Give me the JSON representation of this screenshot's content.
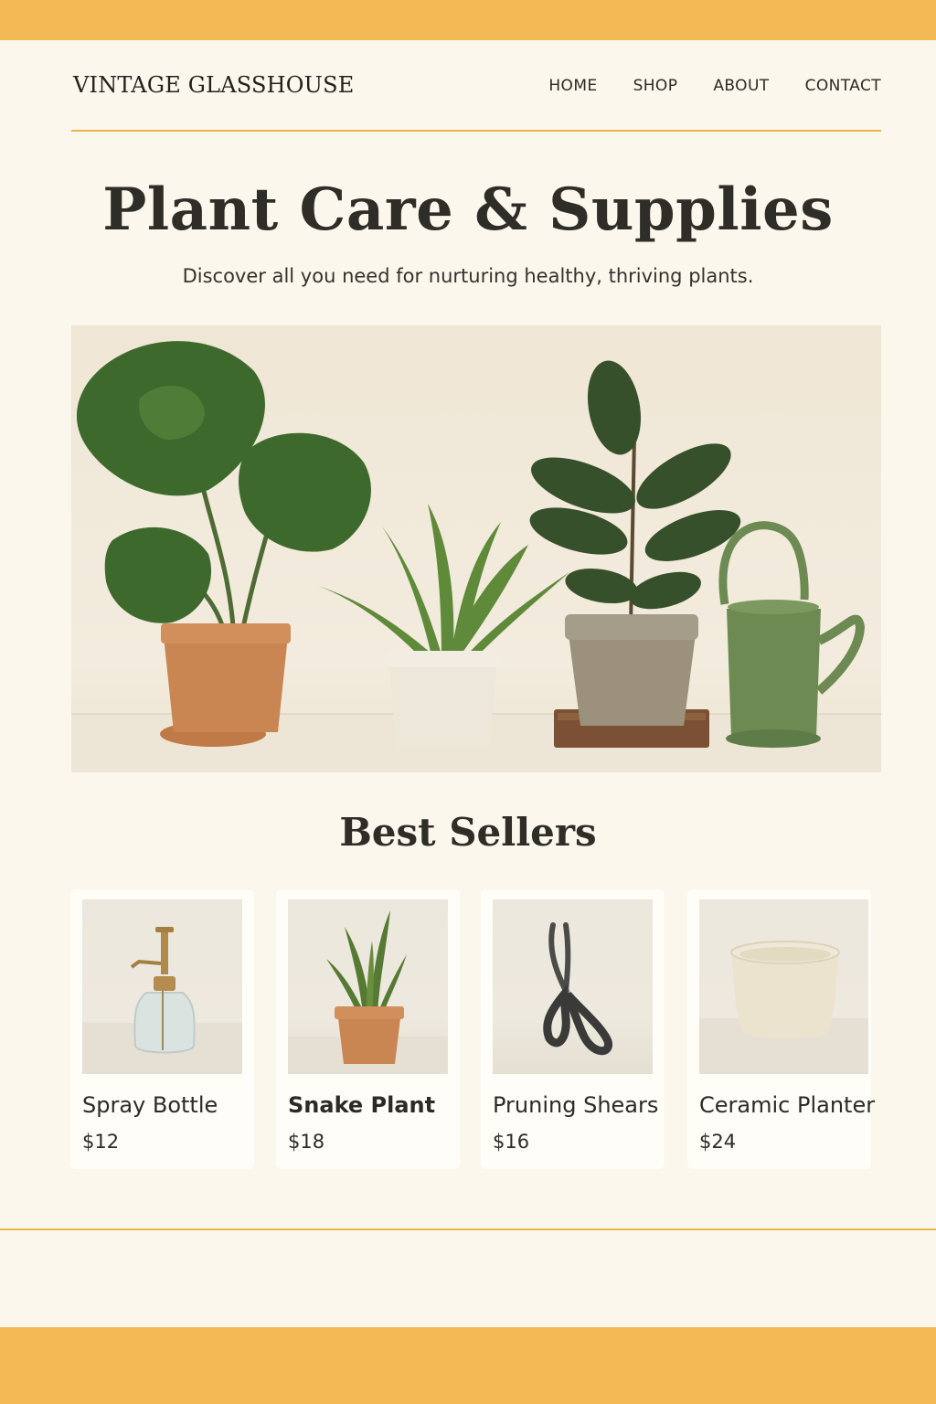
{
  "brand": "VINTAGE GLASSHOUSE",
  "nav": [
    "HOME",
    "SHOP",
    "ABOUT",
    "CONTACT"
  ],
  "hero": {
    "title": "Plant Care & Supplies",
    "subtitle": "Discover all you need for nurturing healthy, thriving plants.",
    "image": "plants-on-shelf-photo"
  },
  "best_sellers": {
    "title": "Best Sellers",
    "products": [
      {
        "name": "Spray Bottle",
        "price": "$12",
        "image": "spray-bottle-photo"
      },
      {
        "name": "Snake Plant",
        "price": "$18",
        "image": "snake-plant-photo"
      },
      {
        "name": "Pruning Shears",
        "price": "$16",
        "image": "pruning-shears-photo"
      },
      {
        "name": "Ceramic Planter",
        "price": "$24",
        "image": "ceramic-planter-photo"
      }
    ]
  },
  "colors": {
    "accent": "#f2b954",
    "background": "#fcf7ec",
    "text": "#2b2a24"
  }
}
